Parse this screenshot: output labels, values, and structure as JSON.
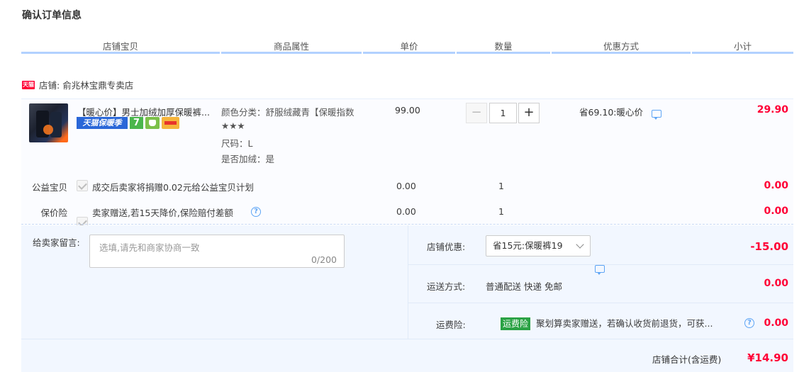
{
  "page_title": "确认订单信息",
  "columns": [
    "店铺宝贝",
    "商品属性",
    "单价",
    "数量",
    "优惠方式",
    "小计"
  ],
  "shop": {
    "badge": "天猫",
    "label": "店铺:",
    "name": "俞兆林宝鼎专卖店"
  },
  "item": {
    "title": "【暖心价】男士加绒加厚保暖裤...",
    "badge_tmall": "天猫保暖季",
    "badge_7": "7",
    "attrs": [
      "颜色分类：舒服绒藏青【保暖指数",
      "★★★",
      "尺码：L",
      "是否加绒：是"
    ],
    "price": "99.00",
    "quantity": "1",
    "qty_minus": "−",
    "qty_plus": "+",
    "promo": "省69.10:暖心价",
    "subtotal": "29.90"
  },
  "charity": {
    "label": "公益宝贝",
    "text": "成交后卖家将捐赠0.02元给公益宝贝计划",
    "price": "0.00",
    "quantity": "1",
    "subtotal": "0.00"
  },
  "insurance": {
    "label": "保价险",
    "text": "卖家赠送,若15天降价,保险赔付差额",
    "price": "0.00",
    "quantity": "1",
    "subtotal": "0.00"
  },
  "message": {
    "label": "给卖家留言:",
    "placeholder": "选填,请先和商家协商一致",
    "count": "0/200"
  },
  "shop_discount": {
    "label": "店铺优惠:",
    "selected": "省15元:保暖裤19",
    "amount": "-15.00"
  },
  "shipping": {
    "label": "运送方式:",
    "value": "普通配送 快递 免邮",
    "amount": "0.00"
  },
  "freight_insurance": {
    "label": "运费险:",
    "tag": "运费险",
    "text": "聚划算卖家赠送，若确认收货前退货，可获...",
    "amount": "0.00"
  },
  "total": {
    "label": "店铺合计(含运费)",
    "amount": "¥14.90"
  },
  "colors": {
    "accent_red": "#ff0036",
    "header_line": "#b2d1ff",
    "panel_bg": "#f2f7ff",
    "tmall_blue": "#2a67d8",
    "green_tag": "#2aa244"
  }
}
